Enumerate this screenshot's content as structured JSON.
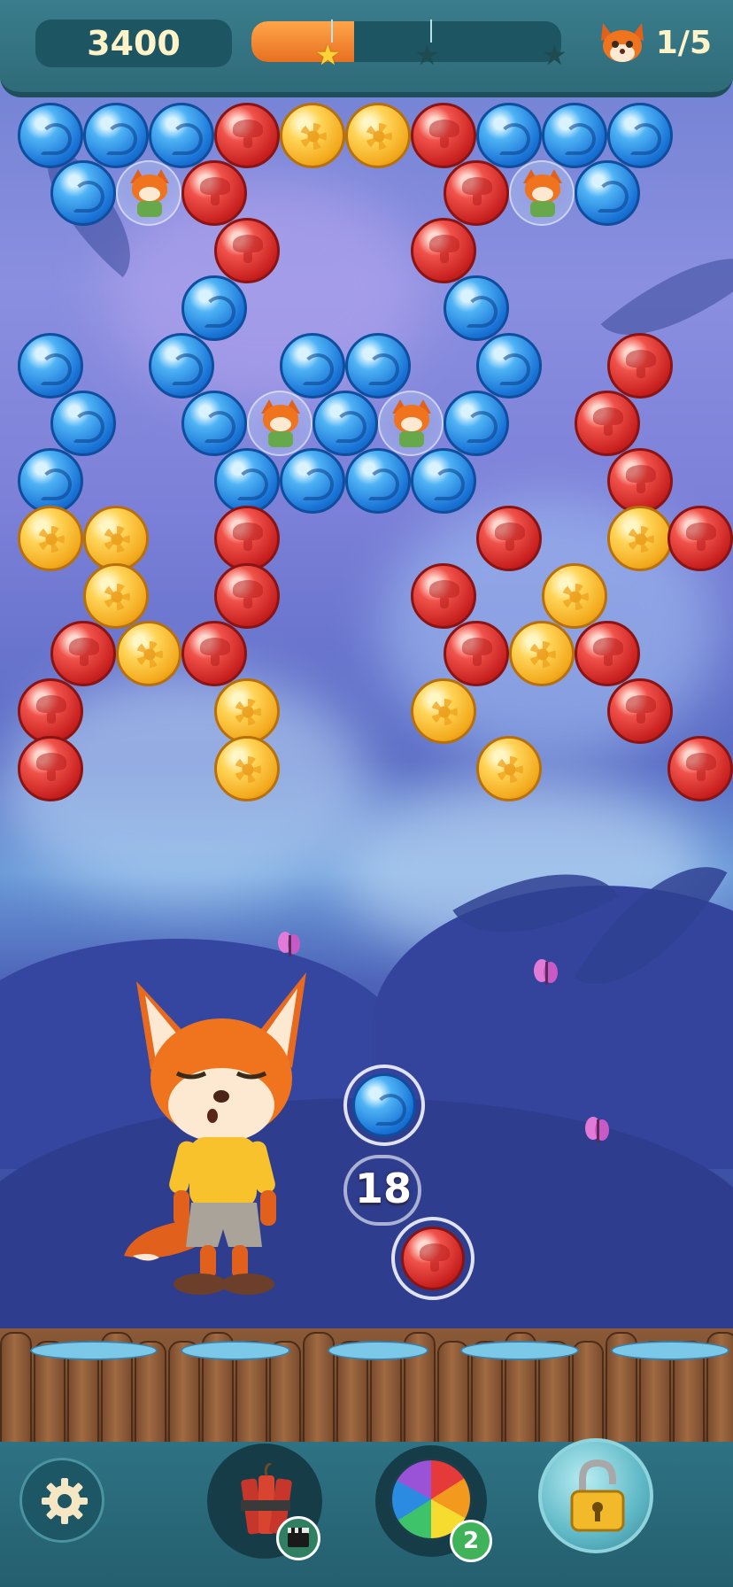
{
  "hud": {
    "score": "3400",
    "progress": 0.33,
    "stars": [
      "earned",
      "empty",
      "empty"
    ],
    "goal_count": "1/5",
    "goal_icon": "fox-head-icon"
  },
  "board": {
    "rows": [
      [
        "blue",
        "blue",
        "blue",
        "red",
        "yellow",
        "yellow",
        "red",
        "blue",
        "blue",
        "blue"
      ],
      [
        "blue",
        "fox",
        "red",
        "",
        "",
        "",
        "red",
        "fox",
        "blue"
      ],
      [
        "",
        "",
        "",
        "red",
        "",
        "",
        "red",
        "",
        "",
        ""
      ],
      [
        "",
        "",
        "blue",
        "",
        "",
        "",
        "blue",
        "",
        ""
      ],
      [
        "blue",
        "",
        "blue",
        "",
        "blue",
        "blue",
        "",
        "blue",
        "",
        "red"
      ],
      [
        "blue",
        "",
        "blue",
        "fox",
        "blue",
        "fox",
        "blue",
        "",
        "red"
      ],
      [
        "blue",
        "",
        "",
        "blue",
        "blue",
        "blue",
        "blue",
        "",
        "",
        "red"
      ],
      [
        "yellow",
        "yellow",
        "",
        "red",
        "",
        "",
        "",
        "red",
        "",
        "yellow",
        "red"
      ],
      [
        "",
        "yellow",
        "",
        "red",
        "",
        "",
        "red",
        "",
        "yellow",
        ""
      ],
      [
        "red",
        "yellow",
        "red",
        "",
        "",
        "",
        "red",
        "yellow",
        "red"
      ],
      [
        "red",
        "",
        "",
        "yellow",
        "",
        "",
        "yellow",
        "",
        "",
        "red"
      ],
      [
        "red",
        "",
        "",
        "yellow",
        "",
        "",
        "",
        "yellow",
        "",
        "",
        "red"
      ]
    ]
  },
  "shooter": {
    "current_bubble": "blue",
    "next_bubble": "red",
    "shots_left": "18"
  },
  "bottom_bar": {
    "settings_icon": "gear-icon",
    "booster_dynamite_icon": "dynamite-icon",
    "booster_dynamite_badge_icon": "video-clapper-icon",
    "booster_rainbow_icon": "rainbow-ball-icon",
    "booster_rainbow_count": "2",
    "booster_lock_icon": "padlock-icon"
  },
  "colors": {
    "blue": "#1973d6",
    "red": "#c8201f",
    "yellow": "#f3a91c",
    "hud_bg": "#2f6b79"
  }
}
